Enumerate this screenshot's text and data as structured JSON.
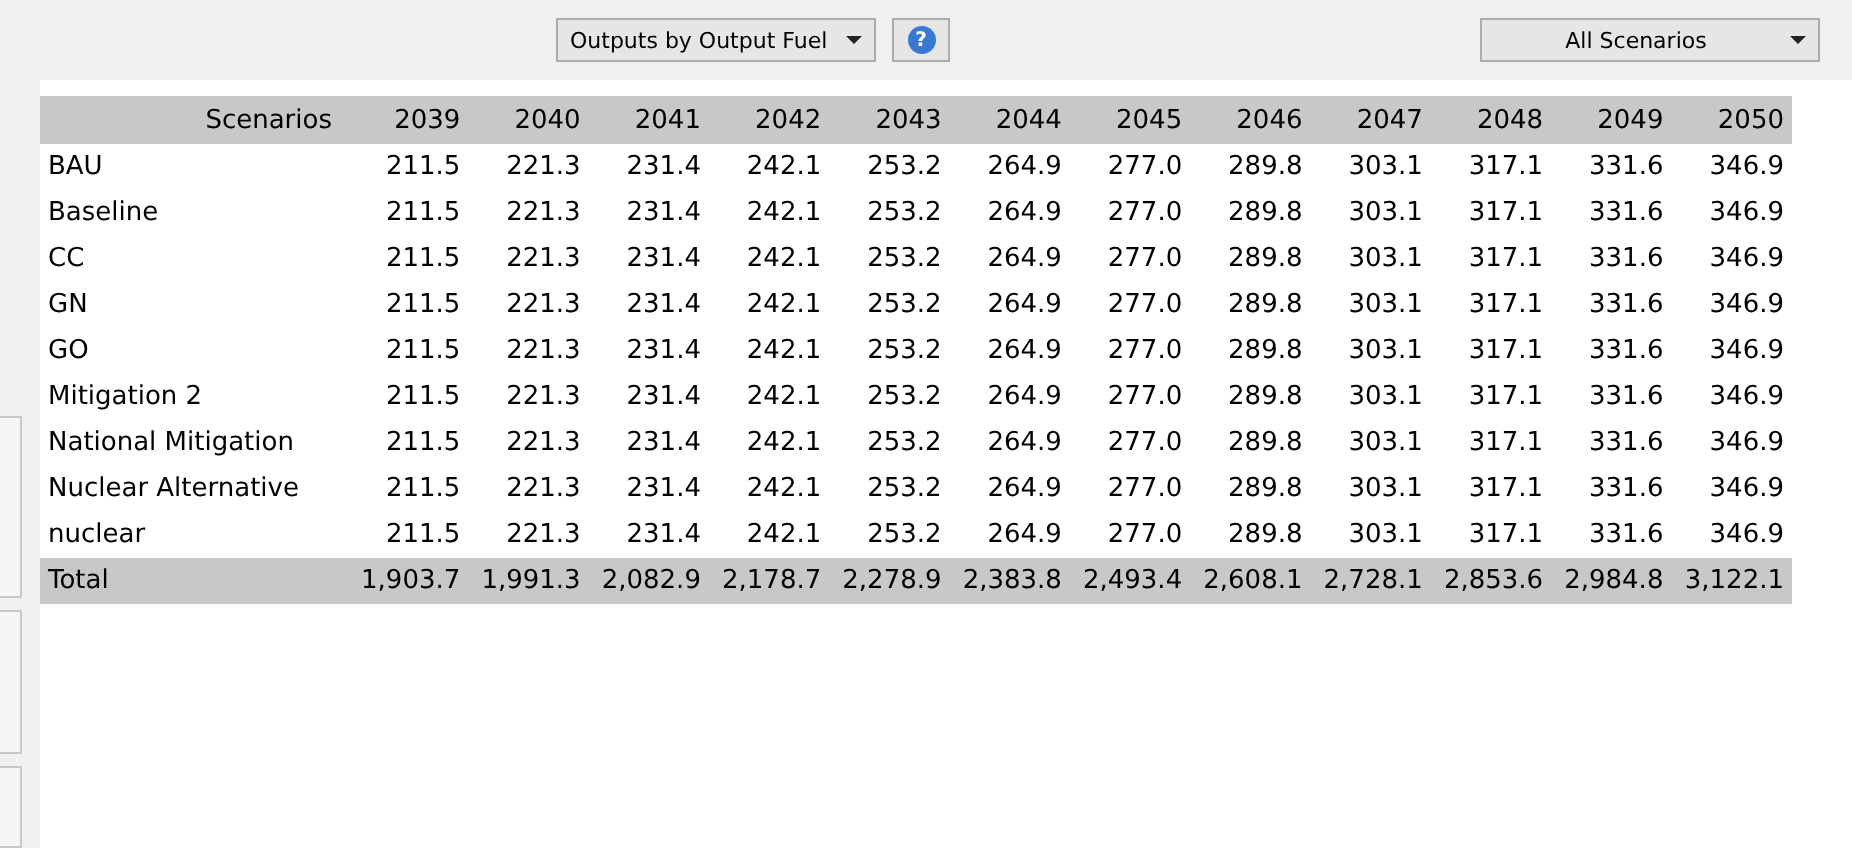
{
  "toolbar": {
    "view_dropdown": "Outputs by Output Fuel",
    "scenario_dropdown": "All Scenarios"
  },
  "help_button": "?",
  "table": {
    "columns": [
      "Scenarios",
      "2039",
      "2040",
      "2041",
      "2042",
      "2043",
      "2044",
      "2045",
      "2046",
      "2047",
      "2048",
      "2049",
      "2050"
    ],
    "rows": [
      [
        "BAU",
        "211.5",
        "221.3",
        "231.4",
        "242.1",
        "253.2",
        "264.9",
        "277.0",
        "289.8",
        "303.1",
        "317.1",
        "331.6",
        "346.9"
      ],
      [
        "Baseline",
        "211.5",
        "221.3",
        "231.4",
        "242.1",
        "253.2",
        "264.9",
        "277.0",
        "289.8",
        "303.1",
        "317.1",
        "331.6",
        "346.9"
      ],
      [
        "CC",
        "211.5",
        "221.3",
        "231.4",
        "242.1",
        "253.2",
        "264.9",
        "277.0",
        "289.8",
        "303.1",
        "317.1",
        "331.6",
        "346.9"
      ],
      [
        "GN",
        "211.5",
        "221.3",
        "231.4",
        "242.1",
        "253.2",
        "264.9",
        "277.0",
        "289.8",
        "303.1",
        "317.1",
        "331.6",
        "346.9"
      ],
      [
        "GO",
        "211.5",
        "221.3",
        "231.4",
        "242.1",
        "253.2",
        "264.9",
        "277.0",
        "289.8",
        "303.1",
        "317.1",
        "331.6",
        "346.9"
      ],
      [
        "Mitigation 2",
        "211.5",
        "221.3",
        "231.4",
        "242.1",
        "253.2",
        "264.9",
        "277.0",
        "289.8",
        "303.1",
        "317.1",
        "331.6",
        "346.9"
      ],
      [
        "National Mitigation",
        "211.5",
        "221.3",
        "231.4",
        "242.1",
        "253.2",
        "264.9",
        "277.0",
        "289.8",
        "303.1",
        "317.1",
        "331.6",
        "346.9"
      ],
      [
        "Nuclear Alternative",
        "211.5",
        "221.3",
        "231.4",
        "242.1",
        "253.2",
        "264.9",
        "277.0",
        "289.8",
        "303.1",
        "317.1",
        "331.6",
        "346.9"
      ],
      [
        "nuclear",
        "211.5",
        "221.3",
        "231.4",
        "242.1",
        "253.2",
        "264.9",
        "277.0",
        "289.8",
        "303.1",
        "317.1",
        "331.6",
        "346.9"
      ]
    ],
    "total": [
      "Total",
      "1,903.7",
      "1,991.3",
      "2,082.9",
      "2,178.7",
      "2,278.9",
      "2,383.8",
      "2,493.4",
      "2,608.1",
      "2,728.1",
      "2,853.6",
      "2,984.8",
      "3,122.1"
    ]
  }
}
